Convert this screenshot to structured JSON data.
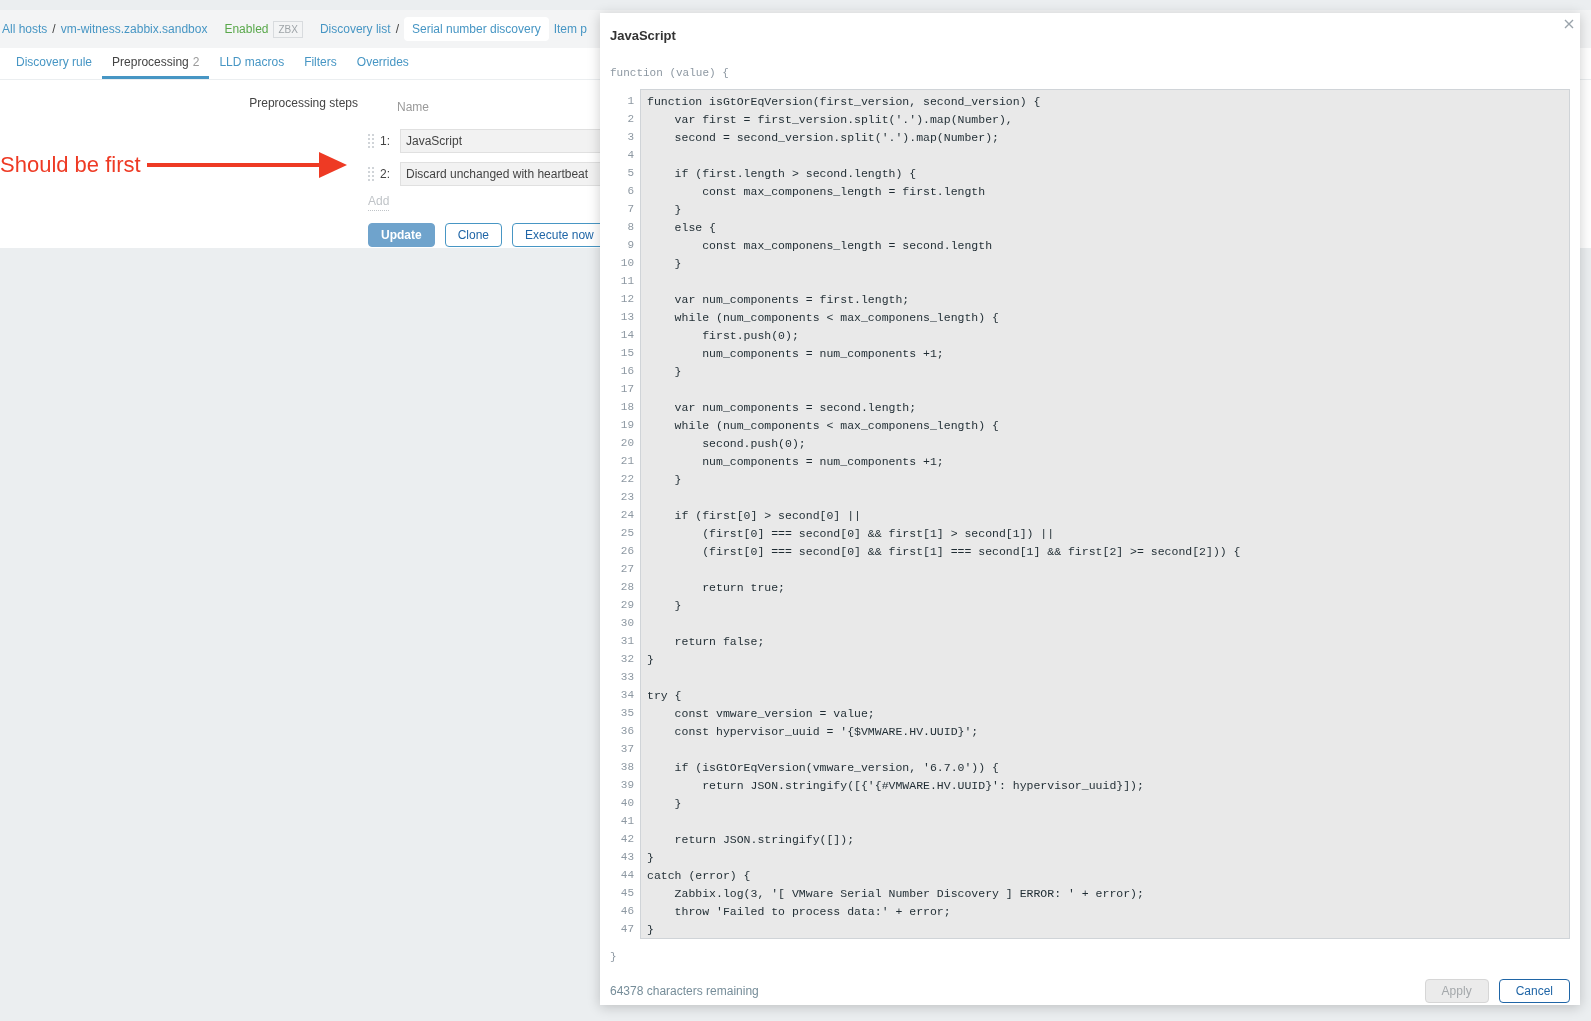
{
  "breadcrumbs": [
    {
      "label": "All hosts",
      "kind": "link"
    },
    {
      "label": "/",
      "kind": "separator"
    },
    {
      "label": "vm-witness.zabbix.sandbox",
      "kind": "link"
    },
    {
      "label": "Enabled",
      "kind": "status"
    },
    {
      "label": "ZBX",
      "kind": "tag"
    },
    {
      "label": "Discovery list",
      "kind": "link"
    },
    {
      "label": "/",
      "kind": "separator"
    },
    {
      "label": "Serial number discovery",
      "kind": "current"
    },
    {
      "label": "Item p",
      "kind": "link"
    }
  ],
  "tabs": [
    {
      "label": "Discovery rule",
      "selected": false
    },
    {
      "label": "Preprocessing",
      "count": "2",
      "selected": true
    },
    {
      "label": "LLD macros",
      "selected": false
    },
    {
      "label": "Filters",
      "selected": false
    },
    {
      "label": "Overrides",
      "selected": false
    }
  ],
  "preprocessing": {
    "label": "Preprocessing steps",
    "column": "Name",
    "steps": [
      {
        "number": "1:",
        "name": "JavaScript"
      },
      {
        "number": "2:",
        "name": "Discard unchanged with heartbeat"
      }
    ],
    "add": "Add"
  },
  "annotation": "Should be first",
  "buttons": [
    {
      "label": "Update",
      "kind": "primary"
    },
    {
      "label": "Clone",
      "kind": "secondary"
    },
    {
      "label": "Execute now",
      "kind": "secondary"
    }
  ],
  "dialog": {
    "title": "JavaScript",
    "header": "function (value) {",
    "footer_brace": "}",
    "remaining": "64378 characters remaining",
    "lines": [
      {
        "n": "1",
        "code": "function isGtOrEqVersion(first_version, second_version) {"
      },
      {
        "n": "2",
        "code": "    var first = first_version.split('.').map(Number),"
      },
      {
        "n": "3",
        "code": "    second = second_version.split('.').map(Number);"
      },
      {
        "n": "4"
      },
      {
        "n": "5",
        "code": "    if (first.length > second.length) {"
      },
      {
        "n": "6",
        "code": "        const max_componens_length = first.length"
      },
      {
        "n": "7",
        "code": "    }"
      },
      {
        "n": "8",
        "code": "    else {"
      },
      {
        "n": "9",
        "code": "        const max_componens_length = second.length"
      },
      {
        "n": "10",
        "code": "    }"
      },
      {
        "n": "11"
      },
      {
        "n": "12",
        "code": "    var num_components = first.length;"
      },
      {
        "n": "13",
        "code": "    while (num_components < max_componens_length) {"
      },
      {
        "n": "14",
        "code": "        first.push(0);"
      },
      {
        "n": "15",
        "code": "        num_components = num_components +1;"
      },
      {
        "n": "16",
        "code": "    }"
      },
      {
        "n": "17"
      },
      {
        "n": "18",
        "code": "    var num_components = second.length;"
      },
      {
        "n": "19",
        "code": "    while (num_components < max_componens_length) {"
      },
      {
        "n": "20",
        "code": "        second.push(0);"
      },
      {
        "n": "21",
        "code": "        num_components = num_components +1;"
      },
      {
        "n": "22",
        "code": "    }"
      },
      {
        "n": "23"
      },
      {
        "n": "24",
        "code": "    if (first[0] > second[0] ||"
      },
      {
        "n": "25",
        "code": "        (first[0] === second[0] && first[1] > second[1]) ||"
      },
      {
        "n": "26",
        "code": "        (first[0] === second[0] && first[1] === second[1] && first[2] >= second[2])) {"
      },
      {
        "n": "27"
      },
      {
        "n": "28",
        "code": "        return true;"
      },
      {
        "n": "29",
        "code": "    }"
      },
      {
        "n": "30"
      },
      {
        "n": "31",
        "code": "    return false;"
      },
      {
        "n": "32",
        "code": "}"
      },
      {
        "n": "33"
      },
      {
        "n": "34",
        "code": "try {"
      },
      {
        "n": "35",
        "code": "    const vmware_version = value;"
      },
      {
        "n": "36",
        "code": "    const hypervisor_uuid = '{$VMWARE.HV.UUID}';"
      },
      {
        "n": "37"
      },
      {
        "n": "38",
        "code": "    if (isGtOrEqVersion(vmware_version, '6.7.0')) {"
      },
      {
        "n": "39",
        "code": "        return JSON.stringify([{'{#VMWARE.HV.UUID}': hypervisor_uuid}]);"
      },
      {
        "n": "40",
        "code": "    }"
      },
      {
        "n": "41"
      },
      {
        "n": "42",
        "code": "    return JSON.stringify([]);"
      },
      {
        "n": "43",
        "code": "}"
      },
      {
        "n": "44",
        "code": "catch (error) {"
      },
      {
        "n": "45",
        "code": "    Zabbix.log(3, '[ VMware Serial Number Discovery ] ERROR: ' + error);"
      },
      {
        "n": "46",
        "code": "    throw 'Failed to process data:' + error;"
      },
      {
        "n": "47",
        "code": "}"
      }
    ],
    "buttons": [
      {
        "label": "Apply",
        "disabled": true
      },
      {
        "label": "Cancel",
        "disabled": false
      }
    ]
  }
}
